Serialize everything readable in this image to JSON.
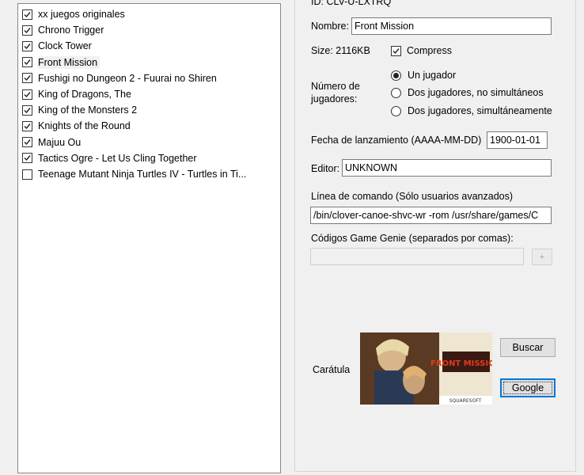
{
  "game_list": [
    {
      "label": "xx juegos originales",
      "checked": true
    },
    {
      "label": "Chrono Trigger",
      "checked": true
    },
    {
      "label": "Clock Tower",
      "checked": true
    },
    {
      "label": "Front Mission",
      "checked": true,
      "selected": true
    },
    {
      "label": "Fushigi no Dungeon 2 - Fuurai no Shiren",
      "checked": true
    },
    {
      "label": "King of Dragons, The",
      "checked": true
    },
    {
      "label": "King of the Monsters 2",
      "checked": true
    },
    {
      "label": "Knights of the Round",
      "checked": true
    },
    {
      "label": "Majuu Ou",
      "checked": true
    },
    {
      "label": "Tactics Ogre - Let Us Cling Together",
      "checked": true
    },
    {
      "label": "Teenage Mutant Ninja Turtles IV - Turtles in Ti..."
    }
  ],
  "details": {
    "id_label": "ID: CLV-U-LXTRQ",
    "name_label": "Nombre:",
    "name_value": "Front Mission",
    "size_label": "Size: 2116KB",
    "compress_label": "Compress",
    "compress_checked": true,
    "players_label_1": "Número de",
    "players_label_2": "jugadores:",
    "players_options": [
      "Un jugador",
      "Dos jugadores, no simultáneos",
      "Dos jugadores, simultáneamente"
    ],
    "players_selected": 0,
    "release_label": "Fecha de lanzamiento (AAAA-MM-DD)",
    "release_value": "1900-01-01",
    "publisher_label": "Editor:",
    "publisher_value": "UNKNOWN",
    "cmdline_label": "Línea de comando (Sólo usuarios avanzados)",
    "cmdline_value": "/bin/clover-canoe-shvc-wr -rom /usr/share/games/C",
    "genie_label": "Códigos Game Genie (separados por comas):",
    "genie_value": "",
    "genie_button": "+",
    "cover_label": "Carátula",
    "browse_button": "Buscar",
    "google_button": "Google",
    "cover_title": "FRONT MISSION",
    "cover_publisher": "SQUARESOFT"
  },
  "colors": {
    "list_border": "#828790",
    "focus_border": "#0078d7"
  }
}
